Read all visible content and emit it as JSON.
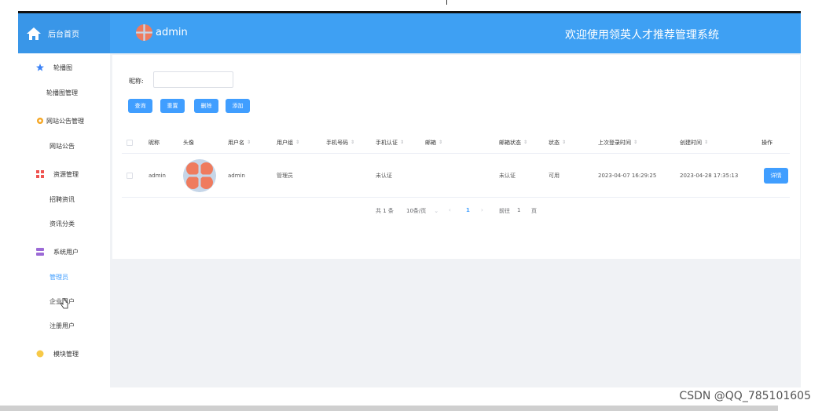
{
  "header": {
    "home_label": "后台首页",
    "user_name": "admin",
    "system_title": "欢迎使用领英人才推荐管理系统"
  },
  "sidebar": {
    "groups": [
      {
        "label": "轮播图",
        "icon": "star-icon",
        "items": [
          "轮播图管理"
        ]
      },
      {
        "label": "网站公告管理",
        "icon": "gear-icon",
        "items": [
          "网站公告"
        ]
      },
      {
        "label": "资源管理",
        "icon": "grid-icon",
        "items": [
          "招聘资讯",
          "资讯分类"
        ]
      },
      {
        "label": "系统用户",
        "icon": "database-icon",
        "items": [
          "管理员",
          "企业用户",
          "注册用户"
        ]
      },
      {
        "label": "模块管理",
        "icon": "circle-icon",
        "items": []
      }
    ],
    "active_item": "管理员"
  },
  "search": {
    "label": "昵称:",
    "value": "",
    "placeholder": ""
  },
  "buttons": {
    "query": "查询",
    "reset": "重置",
    "delete": "删除",
    "add": "添加"
  },
  "table": {
    "columns": [
      "昵称",
      "头像",
      "用户名",
      "用户组",
      "手机号码",
      "手机认证",
      "邮箱",
      "邮箱状态",
      "状态",
      "上次登录时间",
      "创建时间",
      "操作"
    ],
    "rows": [
      {
        "nickname": "admin",
        "username": "admin",
        "group": "管理员",
        "phone": "",
        "phone_verify": "未认证",
        "email": "",
        "email_status": "未认证",
        "status": "可用",
        "last_login": "2023-04-07 16:29:25",
        "created": "2023-04-28 17:35:13",
        "action": "详情"
      }
    ]
  },
  "pagination": {
    "total": "共 1 条",
    "page_size": "10条/页",
    "current_page": "1",
    "goto_label": "前往",
    "goto_value": "1",
    "page_unit": "页"
  },
  "colors": {
    "header_bg": "#3ea0f3",
    "accent": "#409eff"
  },
  "watermark": "CSDN @QQ_785101605"
}
